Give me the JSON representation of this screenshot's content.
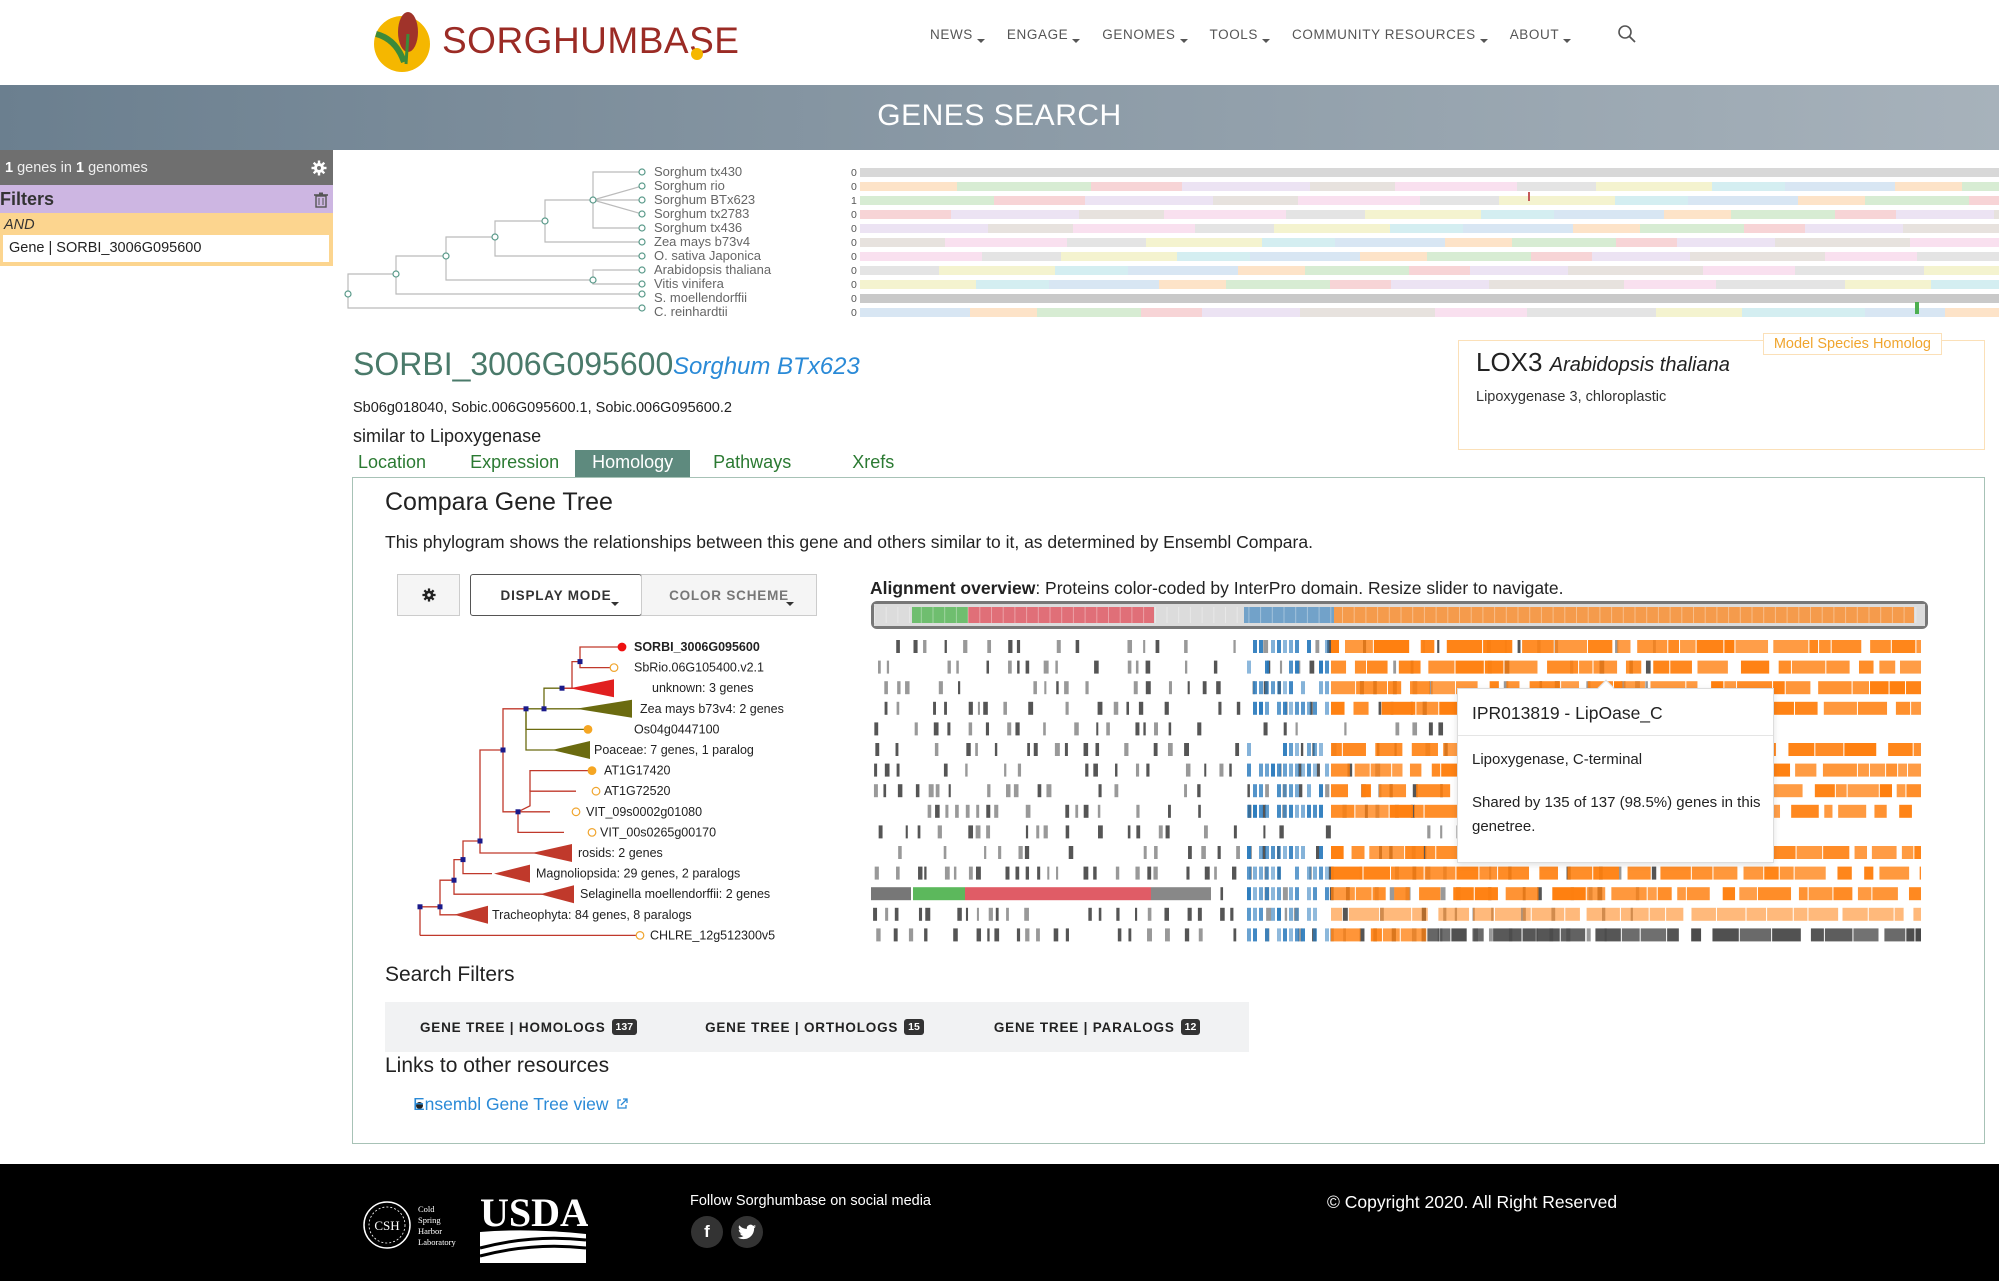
{
  "header": {
    "logo_text": "SORGHUMBASE",
    "nav": [
      "NEWS",
      "ENGAGE",
      "GENOMES",
      "TOOLS",
      "COMMUNITY RESOURCES",
      "ABOUT"
    ],
    "search_icon": "search-icon"
  },
  "banner": {
    "title": "GENES SEARCH"
  },
  "sidebar": {
    "count_n": "1",
    "count_mid": " genes in ",
    "count_g": "1",
    "count_end": " genomes",
    "filters_label": "Filters",
    "and_label": "AND",
    "filter_value": "Gene | SORBI_3006G095600"
  },
  "species_tree": {
    "species": [
      "Sorghum tx430",
      "Sorghum rio",
      "Sorghum BTx623",
      "Sorghum tx2783",
      "Sorghum tx436",
      "Zea mays b73v4",
      "O. sativa Japonica",
      "Arabidopsis thaliana",
      "Vitis vinifera",
      "S. moellendorffii",
      "C. reinhardtii"
    ],
    "counts": [
      "0",
      "0",
      "1",
      "0",
      "0",
      "0",
      "0",
      "0",
      "0",
      "0",
      "0"
    ]
  },
  "gene": {
    "id": "SORBI_3006G095600",
    "species": "Sorghum BTx623",
    "synonyms": "Sb06g018040, Sobic.006G095600.1, Sobic.006G095600.2",
    "description": "similar to Lipoxygenase"
  },
  "homolog": {
    "tag": "Model Species Homolog",
    "name": "LOX3",
    "species": "Arabidopsis thaliana",
    "description": "Lipoxygenase 3, chloroplastic"
  },
  "tabs": [
    "Location",
    "Expression",
    "Homology",
    "Pathways",
    "Xrefs"
  ],
  "active_tab": "Homology",
  "panel": {
    "title": "Compara Gene Tree",
    "description": "This phylogram shows the relationships between this gene and others similar to it, as determined by Ensembl Compara.",
    "display_mode": "DISPLAY MODE",
    "color_scheme": "COLOR SCHEME"
  },
  "gene_tree": {
    "leaves": [
      "SORBI_3006G095600",
      "SbRio.06G105400.v2.1",
      "unknown: 3 genes",
      "Zea mays b73v4: 2 genes",
      "Os04g0447100",
      "Poaceae: 7 genes, 1 paralog",
      "AT1G17420",
      "AT1G72520",
      "VIT_09s0002g01080",
      "VIT_00s0265g00170",
      "rosids: 2 genes",
      "Magnoliopsida: 29 genes, 2 paralogs",
      "Selaginella moellendorffii: 2 genes",
      "Tracheophyta: 84 genes, 8 paralogs",
      "CHLRE_12g512300v5"
    ]
  },
  "alignment": {
    "title_bold": "Alignment overview",
    "title_rest": ": Proteins color-coded by InterPro domain. Resize slider to navigate.",
    "colors": {
      "green": "#5cb85c",
      "red": "#e05c66",
      "blue": "#2b7bbd",
      "orange": "#ff7f0e",
      "gray": "#555555"
    }
  },
  "tooltip": {
    "title": "IPR013819 - LipOase_C",
    "desc": "Lipoxygenase, C-terminal",
    "share": "Shared by 135 of 137 (98.5%) genes in this genetree."
  },
  "search_filters": {
    "title": "Search Filters",
    "items": [
      {
        "label": "GENE TREE | HOMOLOGS",
        "count": "137"
      },
      {
        "label": "GENE TREE | ORTHOLOGS",
        "count": "15"
      },
      {
        "label": "GENE TREE | PARALOGS",
        "count": "12"
      }
    ]
  },
  "links": {
    "title": "Links to other resources",
    "item": "Ensembl Gene Tree view"
  },
  "footer": {
    "follow": "Follow Sorghumbase on social media",
    "copyright": "© Copyright 2020. All Right Reserved",
    "csh_text": "Cold Spring Harbor Laboratory",
    "usda_text": "USDA"
  }
}
